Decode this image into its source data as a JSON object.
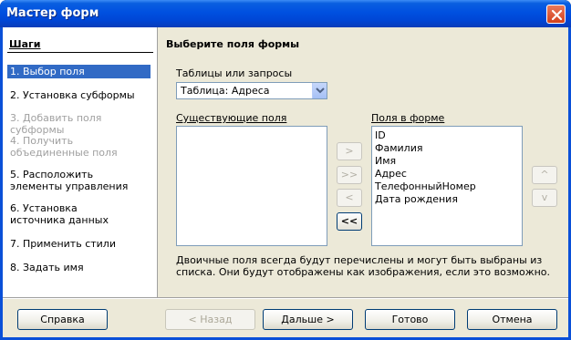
{
  "window": {
    "title": "Мастер форм"
  },
  "steps": {
    "title": "Шаги",
    "items": [
      {
        "label": "1. Выбор поля",
        "state": "active"
      },
      {
        "label": "2. Установка субформы",
        "state": "normal"
      },
      {
        "label": "3. Добавить поля субформы",
        "state": "disabled"
      },
      {
        "label": "4. Получить объединенные поля",
        "state": "disabled"
      },
      {
        "label": "5. Расположить элементы управления",
        "state": "normal"
      },
      {
        "label": "6. Установка источника данных",
        "state": "normal"
      },
      {
        "label": "7. Применить стили",
        "state": "normal"
      },
      {
        "label": "8. Задать имя",
        "state": "normal"
      }
    ]
  },
  "main": {
    "title": "Выберите поля формы",
    "tables_label": "Таблицы или запросы",
    "tables_value": "Таблица: Адреса",
    "existing_label": "Существующие поля",
    "form_label": "Поля в форме",
    "existing_fields": [],
    "form_fields": [
      "ID",
      "Фамилия",
      "Имя",
      "Адрес",
      "ТелефонныйНомер",
      "Дата рождения"
    ],
    "move_buttons": [
      ">",
      ">>",
      "<",
      "<<"
    ],
    "order_buttons": [
      "^",
      "v"
    ],
    "note": "Двоичные поля всегда будут перечислены и могут быть выбраны из списка. Они будут отображены как изображения, если это возможно."
  },
  "footer": {
    "help": "Справка",
    "back": "< Назад",
    "next": "Дальше >",
    "finish": "Готово",
    "cancel": "Отмена"
  },
  "colors": {
    "titlebar": "#0054e3",
    "selection": "#316ac5",
    "dialog_bg": "#ece9d8"
  }
}
